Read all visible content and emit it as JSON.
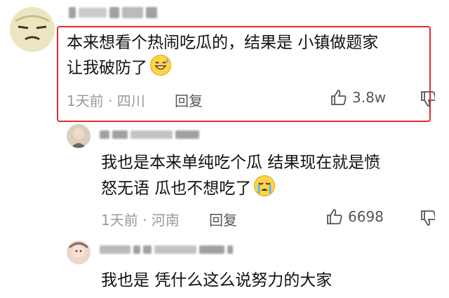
{
  "colors": {
    "highlight": "#e02b2b",
    "meta": "#999999",
    "text": "#111111"
  },
  "comments": [
    {
      "username": "",
      "text_line1": "本来想看个热闹吃瓜的，结果是 小镇做题家",
      "text_line2": "让我破防了",
      "emoji_icon": "grinning-sweat-emoji",
      "time_location": "1天前 · 四川",
      "reply_label": "回复",
      "like_count": "3.8w"
    },
    {
      "username": "",
      "text_line1": "我也是本来单纯吃个瓜 结果现在就是愤",
      "text_line2": "怒无语 瓜也不想吃了",
      "emoji_icon": "crying-emoji",
      "time_location": "1天前 · 河南",
      "reply_label": "回复",
      "like_count": "6698"
    },
    {
      "username": "",
      "text_line1": "我也是 凭什么这么说努力的大家"
    }
  ]
}
